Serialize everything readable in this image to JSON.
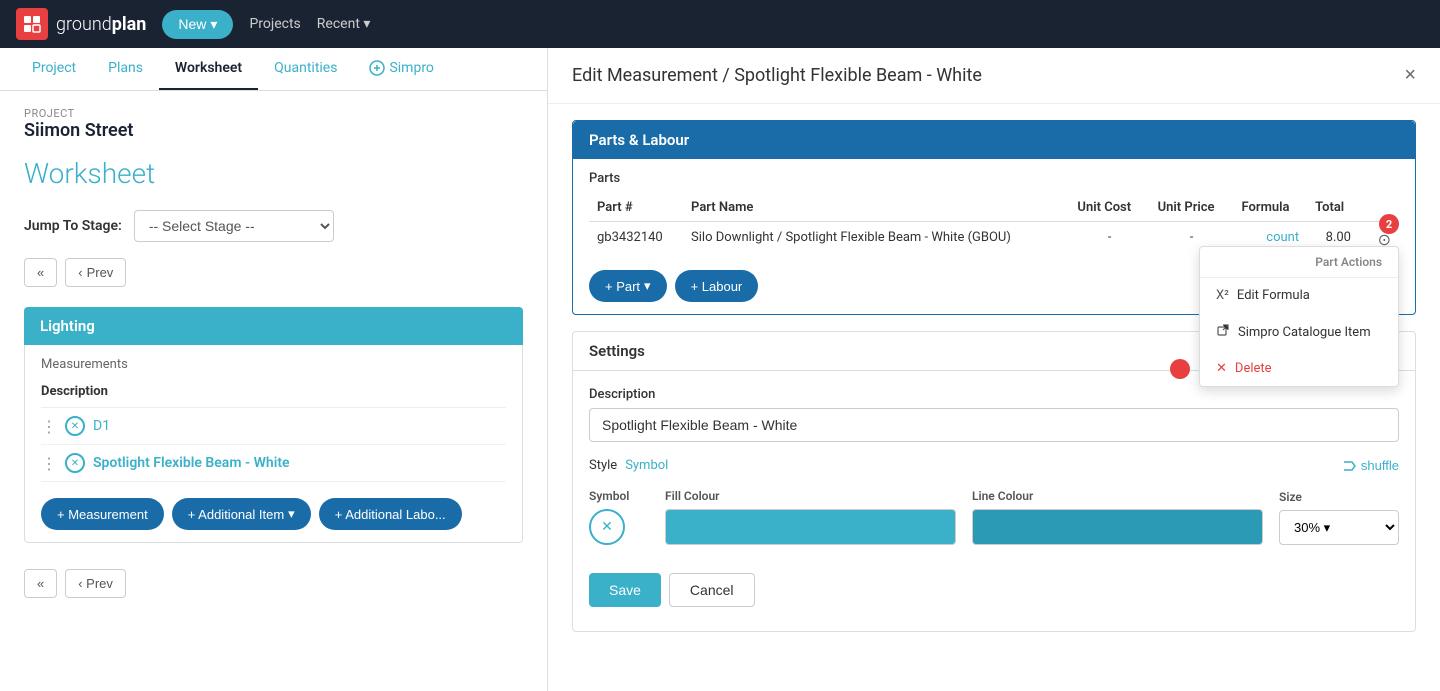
{
  "app": {
    "name_light": "ground",
    "name_bold": "plan",
    "logo_text": "gp"
  },
  "nav": {
    "new_label": "New",
    "projects_label": "Projects",
    "recent_label": "Recent"
  },
  "project": {
    "label": "PROJECT",
    "name": "Siimon Street"
  },
  "tabs": [
    {
      "id": "project",
      "label": "Project",
      "active": false
    },
    {
      "id": "plans",
      "label": "Plans",
      "active": false
    },
    {
      "id": "worksheet",
      "label": "Worksheet",
      "active": true
    },
    {
      "id": "quantities",
      "label": "Quantities",
      "active": false
    },
    {
      "id": "simpro",
      "label": "Simpro",
      "active": false
    }
  ],
  "page": {
    "title": "Worksheet",
    "jump_label": "Jump To Stage:",
    "stage_placeholder": "-- Select Stage --"
  },
  "nav_controls": {
    "double_prev": "«",
    "prev": "Prev"
  },
  "section": {
    "title": "Lighting",
    "measurements_label": "Measurements",
    "desc_header": "Description",
    "rows": [
      {
        "id": "d1",
        "name": "D1",
        "active": false
      },
      {
        "id": "sfbw",
        "name": "Spotlight Flexible Beam - White",
        "active": true
      }
    ]
  },
  "action_buttons": {
    "measurement": "+ Measurement",
    "additional_item": "+ Additional Item",
    "additional_labour": "+ Additional Labo..."
  },
  "modal": {
    "title": "Edit Measurement / Spotlight Flexible Beam - White",
    "close": "×",
    "parts_labour": {
      "header": "Parts & Labour",
      "parts_label": "Parts",
      "columns": {
        "part_num": "Part #",
        "part_name": "Part Name",
        "unit_cost": "Unit Cost",
        "unit_price": "Unit Price",
        "formula": "Formula",
        "total": "Total"
      },
      "rows": [
        {
          "part_num": "gb3432140",
          "part_name": "Silo Downlight / Spotlight Flexible Beam - White (GBOU)",
          "unit_cost": "-",
          "unit_price": "-",
          "formula": "count",
          "total": "8.00",
          "badge": "2"
        }
      ],
      "add_part": "+ Part",
      "add_labour": "+ Labour"
    },
    "dropdown": {
      "label": "Part Actions",
      "edit_formula": "Edit Formula",
      "simpro_catalogue": "Simpro Catalogue Item",
      "delete": "Delete"
    },
    "settings": {
      "header": "Settings",
      "description_label": "Description",
      "description_value": "Spotlight Flexible Beam - White",
      "style_label": "Style",
      "style_value": "Symbol",
      "shuffle_label": "shuffle",
      "symbol_col": "Symbol",
      "fill_colour_col": "Fill Colour",
      "line_colour_col": "Line Colour",
      "size_col": "Size",
      "size_value": "30%"
    },
    "form": {
      "save": "Save",
      "cancel": "Cancel"
    }
  }
}
